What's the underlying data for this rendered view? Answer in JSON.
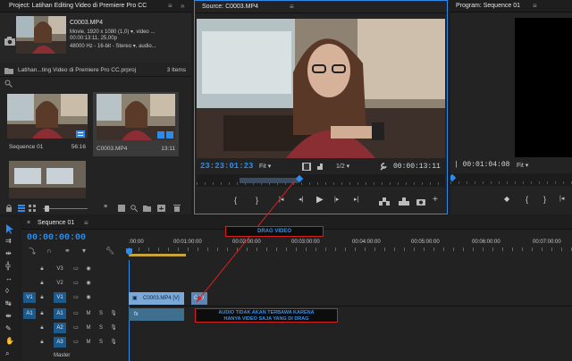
{
  "project": {
    "tab_title": "Project: Latihan Editing Video di Premiere Pro CC",
    "file_name": "C0003.MP4",
    "meta_line1": "Movie, 1920 x 1080 (1,0)",
    "meta_line1_extra": ", video ...",
    "meta_line2": "00:00:13:11, 25,00p",
    "meta_line3": "48000 Hz - 16-bit - Stereo",
    "meta_line3_extra": ", audio...",
    "project_file": "Latihan...ting Video di Premiere Pro CC.prproj",
    "item_count": "3 Items",
    "items": [
      {
        "name": "Sequence 01",
        "duration": "56:16"
      },
      {
        "name": "C0003.MP4",
        "duration": "13:11"
      }
    ]
  },
  "source": {
    "tab_title": "Source: C0003.MP4",
    "timecode": "23:23:01:23",
    "fit": "Fit",
    "resolution": "1/2",
    "duration": "00:00:13:11"
  },
  "program": {
    "tab_title": "Program: Sequence 01",
    "timecode": "00:01:04:08",
    "fit": "Fit"
  },
  "timeline": {
    "tab_title": "Sequence 01",
    "timecode": "00:00:00:00",
    "ruler": [
      ":00:00",
      "00:01:00:00",
      "00:02:00:00",
      "00:03:00:00",
      "00:04:00:00",
      "00:05:00:00",
      "00:06:00:00",
      "00:07:00:00"
    ],
    "tracks": [
      {
        "src": "",
        "name": "V3",
        "kind": "video"
      },
      {
        "src": "",
        "name": "V2",
        "kind": "video"
      },
      {
        "src": "V1",
        "name": "V1",
        "kind": "video"
      },
      {
        "src": "A1",
        "name": "A1",
        "kind": "audio"
      },
      {
        "src": "",
        "name": "A2",
        "kind": "audio"
      },
      {
        "src": "",
        "name": "A3",
        "kind": "audio"
      }
    ],
    "master_label": "Master",
    "clip_video_label": "C0003.MP4 [V]",
    "clip_video2_label": "C00",
    "audio_clip_mark": "fx"
  },
  "annotations": {
    "drag": "DRAG VIDEO",
    "audio_note_1": "AUDIO TIDAK AKAN TERBAWA KARENA",
    "audio_note_2": "HANYA VIDEO SAJA YANG DI DRAG"
  },
  "colors": {
    "accent": "#2d8ceb",
    "clip_video": "#7aa8d8",
    "clip_audio": "#3f6f8e",
    "annotation": "#d52020"
  }
}
